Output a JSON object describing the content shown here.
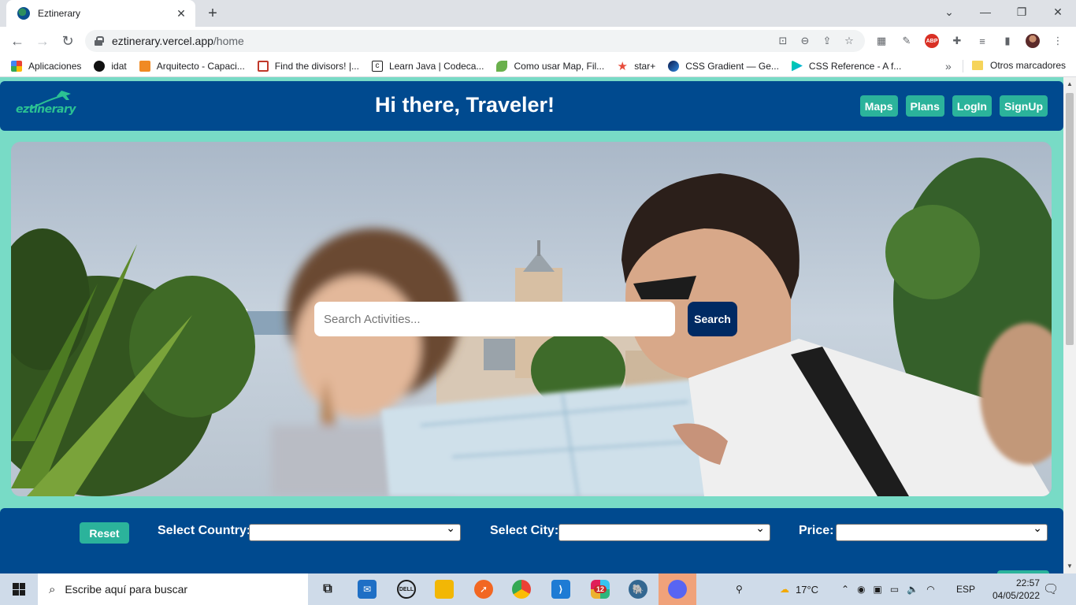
{
  "browser": {
    "tab_title": "Eztinerary",
    "url_host": "eztinerary.vercel.app",
    "url_path": "/home",
    "bookmarks": [
      {
        "label": "Aplicaciones",
        "icon": "apps-grid-icon"
      },
      {
        "label": "idat",
        "icon": "idat-icon"
      },
      {
        "label": "Arquitecto - Capaci...",
        "icon": "cube-icon"
      },
      {
        "label": "Find the divisors! |...",
        "icon": "codewars-icon"
      },
      {
        "label": "Learn Java | Codeca...",
        "icon": "codecademy-icon"
      },
      {
        "label": "Como usar Map, Fil...",
        "icon": "leaf-icon"
      },
      {
        "label": "star+",
        "icon": "star-icon"
      },
      {
        "label": "CSS Gradient — Ge...",
        "icon": "gradient-icon"
      },
      {
        "label": "CSS Reference - A f...",
        "icon": "css-icon"
      }
    ],
    "bookmarks_more": "»",
    "other_bookmarks": "Otros marcadores"
  },
  "site": {
    "logo_text": "eztinerary",
    "title": "Hi there, Traveler!",
    "nav": [
      "Maps",
      "Plans",
      "LogIn",
      "SignUp"
    ],
    "search": {
      "placeholder": "Search Activities...",
      "button": "Search"
    },
    "filters": {
      "reset": "Reset",
      "country_label": "Select Country:",
      "city_label": "Select City:",
      "price_label": "Price:"
    }
  },
  "taskbar": {
    "search_placeholder": "Escribe aquí para buscar",
    "weather": "17°C",
    "language": "ESP",
    "time": "22:57",
    "date": "04/05/2022",
    "slack_badge": "12"
  }
}
